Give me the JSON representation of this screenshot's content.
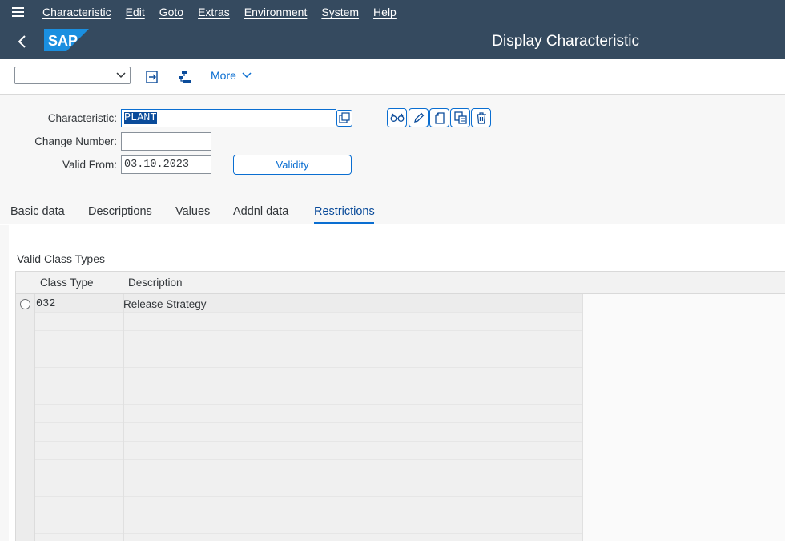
{
  "menu": {
    "items": [
      "Characteristic",
      "Edit",
      "Goto",
      "Extras",
      "Environment",
      "System",
      "Help"
    ]
  },
  "shell": {
    "logo": "SAP",
    "title": "Display Characteristic"
  },
  "toolbar": {
    "command_value": "",
    "more_label": "More"
  },
  "form": {
    "characteristic_label": "Characteristic:",
    "characteristic_value": "PLANT",
    "change_number_label": "Change Number:",
    "change_number_value": "",
    "valid_from_label": "Valid From:",
    "valid_from_value": "03.10.2023",
    "validity_button": "Validity"
  },
  "tabs": [
    "Basic data",
    "Descriptions",
    "Values",
    "Addnl data",
    "Restrictions"
  ],
  "active_tab": "Restrictions",
  "restrictions": {
    "section_title": "Valid Class Types",
    "columns": [
      "Class Type",
      "Description"
    ],
    "rows": [
      {
        "class_type": "032",
        "description": "Release Strategy"
      }
    ]
  },
  "colors": {
    "shell_bg": "#354a5f",
    "accent": "#0a6ed1",
    "selection": "#0a4b9a"
  }
}
